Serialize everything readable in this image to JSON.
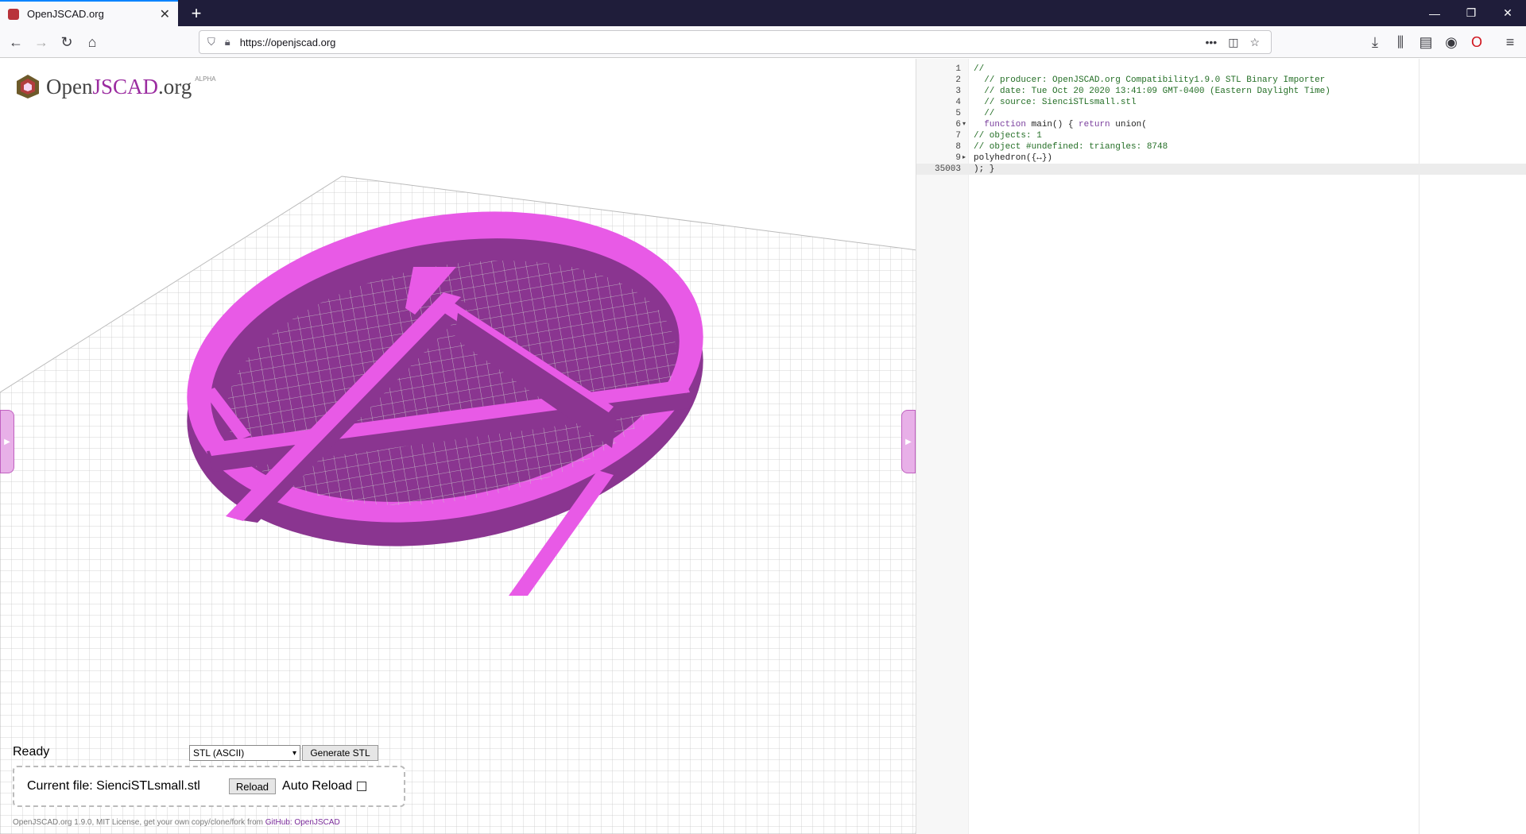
{
  "browser": {
    "tab_title": "OpenJSCAD.org",
    "new_tab": "+",
    "url": "https://openjscad.org",
    "window": {
      "minimize": "—",
      "restore": "❐",
      "close": "✕"
    }
  },
  "app": {
    "logo_text_a": "Open",
    "logo_text_b": "JSCAD",
    "logo_text_c": ".org",
    "logo_badge": "ALPHA",
    "model_color": "#e85ae6",
    "model_shadow": "#8a3590",
    "status": "Ready",
    "format_selected": "STL (ASCII)",
    "generate_label": "Generate STL",
    "current_file": "Current file: SienciSTLsmall.stl",
    "reload_label": "Reload",
    "auto_reload_label": "Auto Reload",
    "footer_text": "OpenJSCAD.org 1.9.0, MIT License, get your own copy/clone/fork from ",
    "footer_link": "GitHub: OpenJSCAD"
  },
  "editor": {
    "lines": [
      {
        "n": "1",
        "parts": [
          {
            "t": "//",
            "c": "com"
          }
        ]
      },
      {
        "n": "2",
        "parts": [
          {
            "t": "  // producer: OpenJSCAD.org Compatibility1.9.0 STL Binary Importer",
            "c": "com"
          }
        ]
      },
      {
        "n": "3",
        "parts": [
          {
            "t": "  // date: Tue Oct 20 2020 13:41:09 GMT-0400 (Eastern Daylight Time)",
            "c": "com"
          }
        ]
      },
      {
        "n": "4",
        "parts": [
          {
            "t": "  // source: SienciSTLsmall.stl",
            "c": "com"
          }
        ]
      },
      {
        "n": "5",
        "parts": [
          {
            "t": "  //",
            "c": "com"
          }
        ]
      },
      {
        "n": "6",
        "fold": "▾",
        "parts": [
          {
            "t": "  function ",
            "c": "kw"
          },
          {
            "t": "main",
            "c": "plain"
          },
          {
            "t": "() { ",
            "c": "plain"
          },
          {
            "t": "return ",
            "c": "kw"
          },
          {
            "t": "union(",
            "c": "plain"
          }
        ]
      },
      {
        "n": "7",
        "parts": [
          {
            "t": "// objects: 1",
            "c": "com"
          }
        ]
      },
      {
        "n": "8",
        "parts": [
          {
            "t": "// object #undefined: triangles: 8748",
            "c": "com"
          }
        ]
      },
      {
        "n": "9",
        "fold": "▸",
        "parts": [
          {
            "t": "polyhedron({",
            "c": "plain"
          },
          {
            "t": "↔",
            "c": "plain"
          },
          {
            "t": "})",
            "c": "plain"
          }
        ]
      },
      {
        "n": "35003",
        "active": true,
        "parts": [
          {
            "t": "); }",
            "c": "plain"
          }
        ]
      }
    ]
  }
}
